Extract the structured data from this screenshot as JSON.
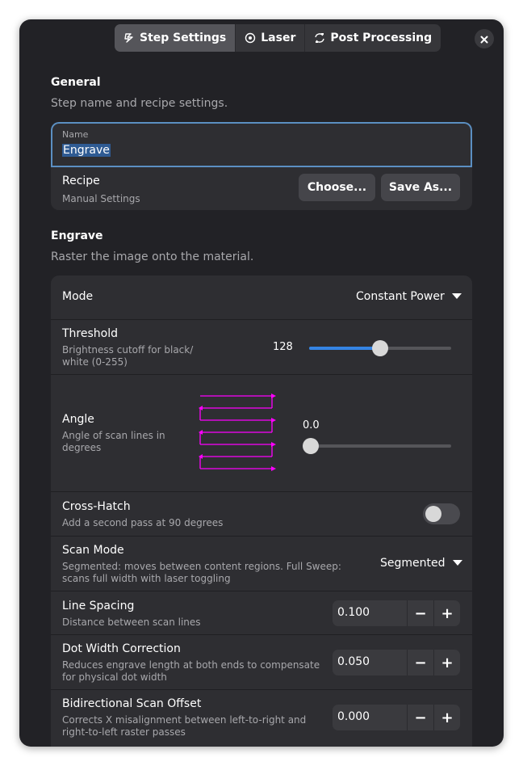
{
  "tabs": [
    {
      "label": "Step Settings",
      "icon": "step-icon",
      "active": true
    },
    {
      "label": "Laser",
      "icon": "laser-icon",
      "active": false
    },
    {
      "label": "Post Processing",
      "icon": "post-processing-icon",
      "active": false
    }
  ],
  "general": {
    "title": "General",
    "subtitle": "Step name and recipe settings.",
    "name_label": "Name",
    "name_value": "Engrave",
    "recipe_title": "Recipe",
    "recipe_subtitle": "Manual Settings",
    "choose_label": "Choose...",
    "save_as_label": "Save As..."
  },
  "engrave": {
    "title": "Engrave",
    "subtitle": "Raster the image onto the material.",
    "mode": {
      "title": "Mode",
      "value": "Constant Power"
    },
    "threshold": {
      "title": "Threshold",
      "subtitle": "Brightness cutoff for black/ white (0-255)",
      "value": "128",
      "level": 0.5
    },
    "angle": {
      "title": "Angle",
      "subtitle": "Angle of scan lines in degrees",
      "value": "0.0",
      "level": 0.0
    },
    "cross_hatch": {
      "title": "Cross-Hatch",
      "subtitle": "Add a second pass at 90 degrees",
      "enabled": false
    },
    "scan_mode": {
      "title": "Scan Mode",
      "subtitle": "Segmented: moves between content regions. Full Sweep: scans full width with laser toggling",
      "value": "Segmented"
    },
    "line_spacing": {
      "title": "Line Spacing",
      "subtitle": "Distance between scan lines",
      "value": "0.100"
    },
    "dot_width": {
      "title": "Dot Width Correction",
      "subtitle": "Reduces engrave length at both ends to compensate for physical dot width",
      "value": "0.050"
    },
    "bidirectional": {
      "title": "Bidirectional Scan Offset",
      "subtitle": "Corrects X misalignment between left-to-right and right-to-left raster passes",
      "value": "0.000"
    }
  },
  "spin": {
    "minus": "−",
    "plus": "+"
  },
  "colors": {
    "accent": "#3584e4",
    "scan_preview": "#ff00ff"
  }
}
